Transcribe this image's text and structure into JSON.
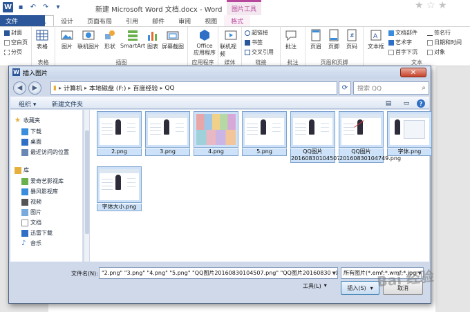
{
  "word": {
    "title": "新建 Microsoft Word 文档.docx - Word",
    "contextual_tab_title": "图片工具",
    "tabs": [
      "文件",
      "开始",
      "插入",
      "设计",
      "页面布局",
      "引用",
      "邮件",
      "审阅",
      "视图",
      "格式"
    ],
    "active_tab": "插入",
    "ribbon": {
      "pages_group": {
        "items": [
          "封面",
          "空白页",
          "分页"
        ]
      },
      "table_label": "表格",
      "illustrations": {
        "buttons": [
          "图片",
          "联机图片",
          "形状",
          "SmartArt",
          "图表",
          "屏幕截图"
        ],
        "label": "插图"
      },
      "apps": {
        "button": "Office",
        "button2": "应用程序",
        "label": "应用程序"
      },
      "media": {
        "button": "联机视频",
        "label": "媒体"
      },
      "links": {
        "items": [
          "超链接",
          "书签",
          "交叉引用"
        ],
        "label": "链接"
      },
      "comments": {
        "button": "批注",
        "label": "批注"
      },
      "header_footer": {
        "buttons": [
          "页眉",
          "页脚",
          "页码"
        ],
        "label": "页眉和页脚"
      },
      "text": {
        "textbox": "文本框",
        "items": [
          "文档部件",
          "艺术字",
          "首字下沉"
        ],
        "items2": [
          "签名行",
          "日期和时间",
          "对象"
        ],
        "label": "文本"
      }
    }
  },
  "dialog": {
    "title": "插入图片",
    "path": [
      "计算机",
      "本地磁盘 (F:)",
      "百度经验",
      "QQ"
    ],
    "search_placeholder": "搜索 QQ",
    "toolbar": {
      "organize": "组织 ▾",
      "new_folder": "新建文件夹"
    },
    "nav": {
      "favorites": "收藏夹",
      "fav_items": [
        "下载",
        "桌面",
        "最近访问的位置"
      ],
      "library": "库",
      "lib_items": [
        "爱奇艺影视库",
        "暴风影视库",
        "视频",
        "图片",
        "文档",
        "迅雷下载",
        "音乐"
      ]
    },
    "files": [
      {
        "name": "2.png",
        "kind": "ui"
      },
      {
        "name": "3.png",
        "kind": "ui"
      },
      {
        "name": "4.png",
        "kind": "colorful"
      },
      {
        "name": "5.png",
        "kind": "ui"
      },
      {
        "name": "QQ图片20160830104507.png",
        "kind": "ui"
      },
      {
        "name": "QQ图片20160830104749.png",
        "kind": "red"
      },
      {
        "name": "字体.png",
        "kind": "panel"
      },
      {
        "name": "字体大小.png",
        "kind": "ui"
      }
    ],
    "filename_label": "文件名(N):",
    "filename_value": "\"2.png\" \"3.png\" \"4.png\" \"5.png\" \"QQ图片20160830104507.png\" \"QQ图片2016083010474",
    "filter_value": "所有图片(*.emf;*.wmf;*.jpg;*",
    "tools_label": "工具(L)",
    "insert_label": "插入(S)",
    "cancel_label": "取消"
  },
  "watermark": "Bai 经验"
}
